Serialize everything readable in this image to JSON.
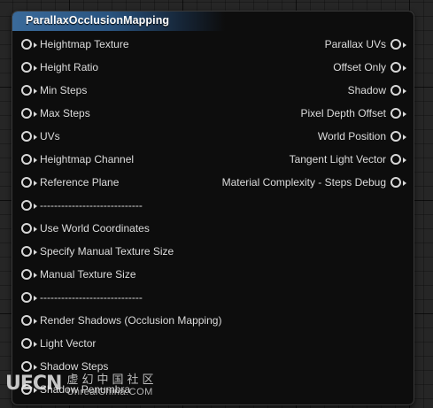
{
  "node": {
    "title": "ParallaxOcclusionMapping",
    "inputs": [
      "Heightmap Texture",
      "Height Ratio",
      "Min Steps",
      "Max Steps",
      "UVs",
      "Heightmap Channel",
      "Reference Plane",
      "-----------------------------",
      "Use World Coordinates",
      "Specify Manual Texture Size",
      "Manual Texture Size",
      "-----------------------------",
      "Render Shadows (Occlusion Mapping)",
      "Light Vector",
      "Shadow Steps",
      "Shadow Penumbra"
    ],
    "outputs": [
      "Parallax UVs",
      "Offset Only",
      "Shadow",
      "Pixel Depth Offset",
      "World Position",
      "Tangent Light Vector",
      "Material Complexity - Steps Debug"
    ],
    "header_color": "#2a5480",
    "pin_color": "#d8d8d8"
  },
  "watermark": {
    "logo": "UECN",
    "cn": "虚幻中国社区",
    "en": "UnrealChina.COM"
  }
}
